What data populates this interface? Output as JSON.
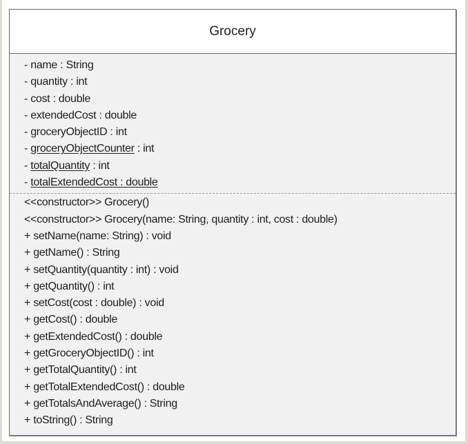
{
  "class_name": "Grocery",
  "attributes": [
    {
      "vis": "- ",
      "underlined": "",
      "text": "name : String"
    },
    {
      "vis": "- ",
      "underlined": "",
      "text": "quantity : int"
    },
    {
      "vis": "- ",
      "underlined": "",
      "text": "cost : double"
    },
    {
      "vis": "- ",
      "underlined": "",
      "text": "extendedCost : double"
    },
    {
      "vis": "- ",
      "underlined": "",
      "text": "groceryObjectID : int"
    },
    {
      "vis": "- ",
      "underlined": "groceryObjectCounter",
      "text": " : int"
    },
    {
      "vis": "- ",
      "underlined": "totalQuantity",
      "text": " : int"
    },
    {
      "vis": "- ",
      "underlined": "totalExtendedCost : double",
      "text": ""
    }
  ],
  "methods": [
    "<<constructor>> Grocery()",
    "<<constructor>> Grocery(name: String, quantity : int, cost : double)",
    "+ setName(name: String) : void",
    "+ getName() : String",
    "+ setQuantity(quantity : int) : void",
    "+ getQuantity() : int",
    "+ setCost(cost : double) : void",
    "+ getCost() : double",
    "+ getExtendedCost() : double",
    "+ getGroceryObjectID() : int",
    "+ getTotalQuantity() : int",
    "+ getTotalExtendedCost() : double",
    "+ getTotalsAndAverage() : String",
    "+ toString() : String"
  ]
}
